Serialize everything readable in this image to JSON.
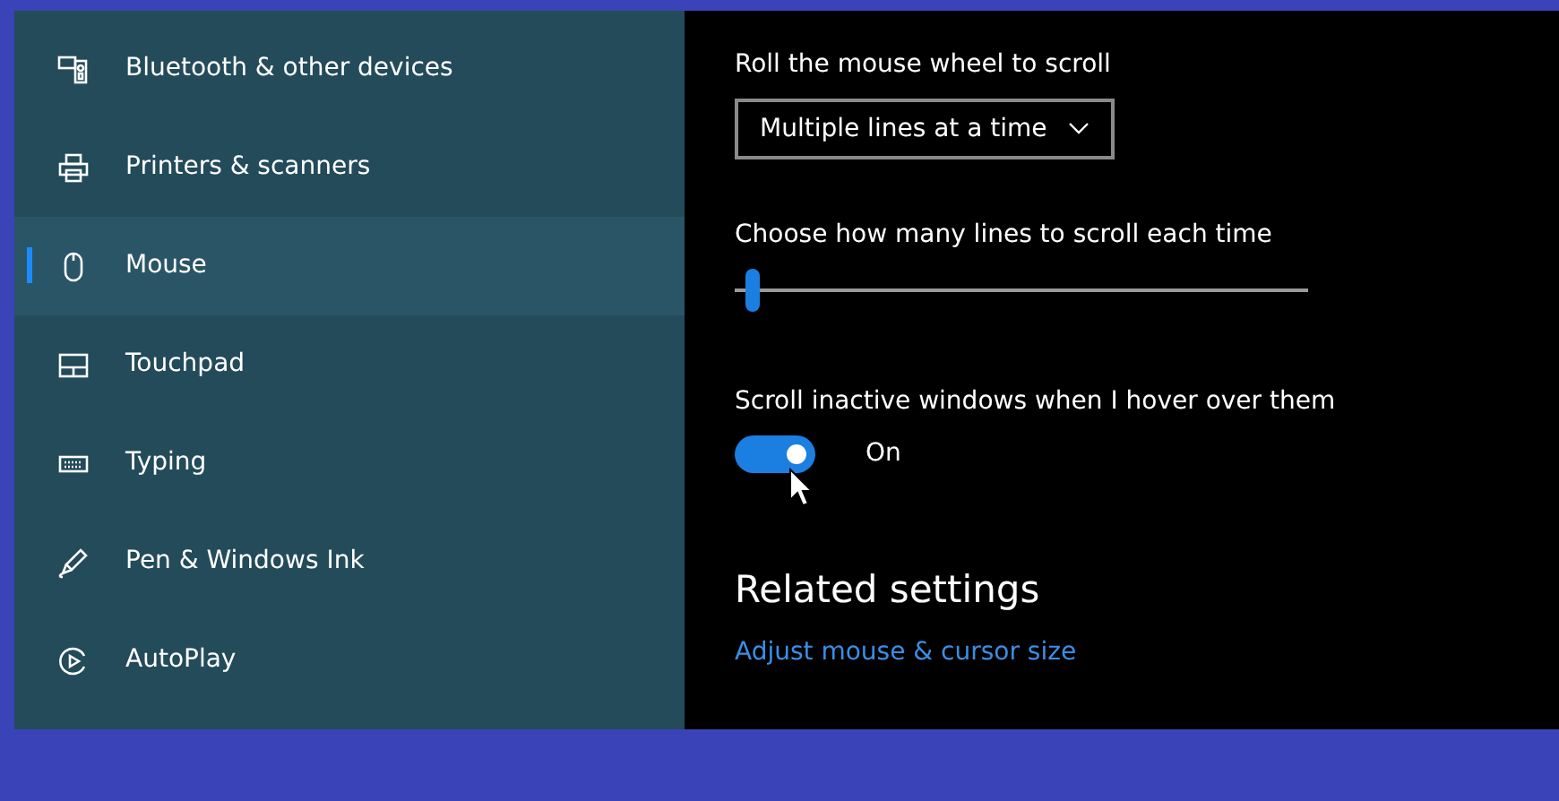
{
  "sidebar": {
    "items": [
      {
        "label": "Bluetooth & other devices",
        "selected": false
      },
      {
        "label": "Printers & scanners",
        "selected": false
      },
      {
        "label": "Mouse",
        "selected": true
      },
      {
        "label": "Touchpad",
        "selected": false
      },
      {
        "label": "Typing",
        "selected": false
      },
      {
        "label": "Pen & Windows Ink",
        "selected": false
      },
      {
        "label": "AutoPlay",
        "selected": false
      }
    ]
  },
  "settings": [
    {
      "kind": "dropdown",
      "label": "Roll the mouse wheel to scroll",
      "value": "Multiple lines at a time"
    },
    {
      "kind": "slider",
      "label": "Choose how many lines to scroll each time",
      "level": 0.02
    },
    {
      "kind": "toggle",
      "label": "Scroll inactive windows when I hover over them",
      "on": true,
      "state_text": "On"
    }
  ],
  "related": {
    "title": "Related settings",
    "links": [
      "Adjust mouse & cursor size"
    ]
  }
}
